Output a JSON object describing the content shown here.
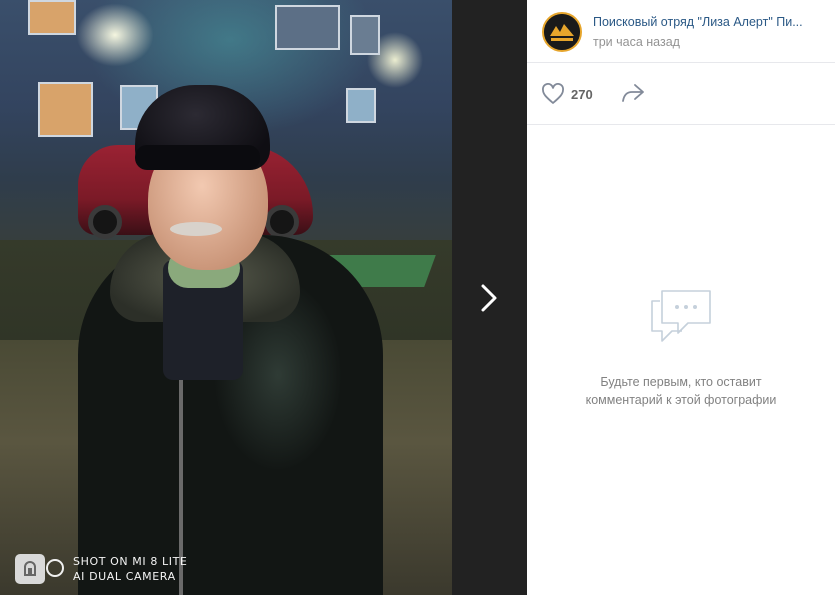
{
  "photo": {
    "watermark_line1": "SHOT ON MI 8 LITE",
    "watermark_line2": "AI DUAL CAMERA"
  },
  "navigation": {
    "next_icon": "chevron-right-icon"
  },
  "post": {
    "author": "Поисковый отряд \"Лиза Алерт\" Пи...",
    "time": "три часа назад",
    "avatar_icon": "lizaalert-logo",
    "likes": "270",
    "like_icon": "heart-icon",
    "share_icon": "share-icon"
  },
  "comments": {
    "empty_icon": "comment-bubble-icon",
    "empty_line1": "Будьте первым, кто оставит",
    "empty_line2": "комментарий к этой фотографии"
  },
  "colors": {
    "link": "#2a5885",
    "muted": "#939393",
    "viewer_bg": "#222222",
    "avatar_ring": "#e6a52c"
  }
}
